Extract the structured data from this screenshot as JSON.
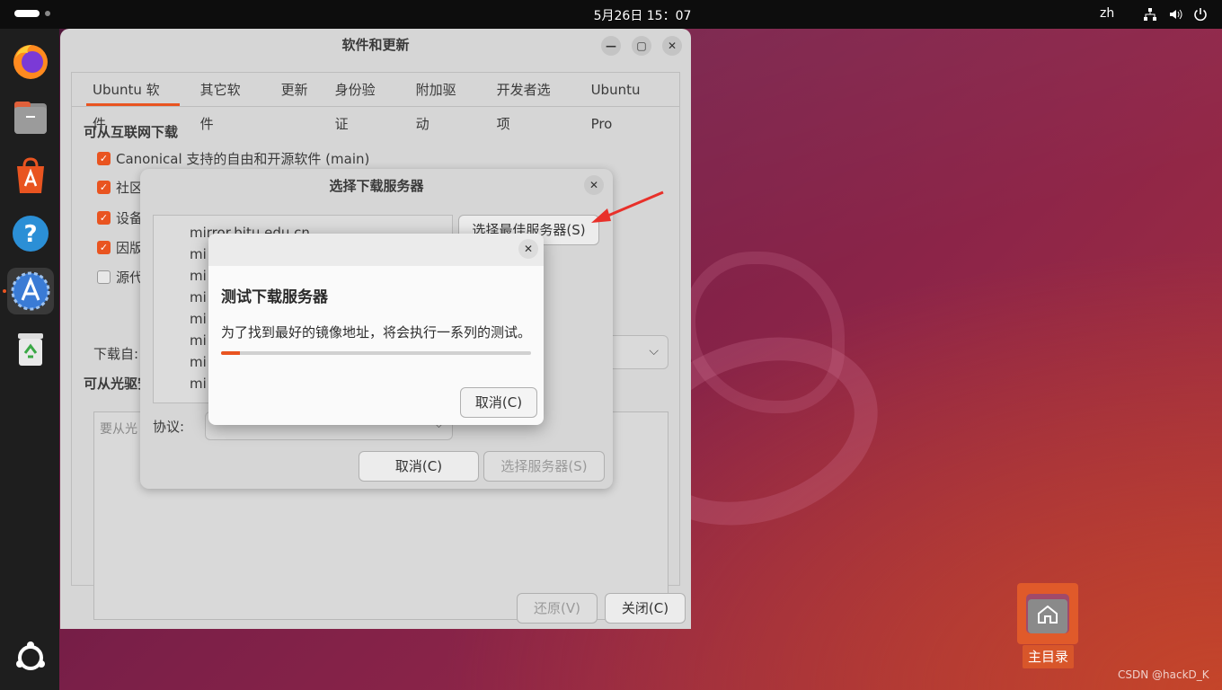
{
  "topbar": {
    "clock": "5月26日  15：07",
    "language": "zh",
    "icons": [
      "network-icon",
      "volume-icon",
      "power-icon"
    ]
  },
  "dock": {
    "apps": [
      "firefox",
      "files",
      "app-center",
      "help",
      "software-updater",
      "trash"
    ],
    "show_apps": "ubuntu-logo"
  },
  "main_window": {
    "title": "软件和更新",
    "tabs": [
      "Ubuntu 软件",
      "其它软件",
      "更新",
      "身份验证",
      "附加驱动",
      "开发者选项",
      "Ubuntu Pro"
    ],
    "active_tab": 0,
    "internet_section": "可从互联网下载",
    "sources": [
      {
        "label": "Canonical 支持的自由和开源软件 (main)",
        "checked": true
      },
      {
        "label": "社区",
        "checked": true
      },
      {
        "label": "设备",
        "checked": true
      },
      {
        "label": "因版",
        "checked": true
      },
      {
        "label": "源代",
        "checked": false
      }
    ],
    "download_from_label": "下载自:",
    "cdrom_section": "可从光驱安",
    "cdrom_placeholder": "要从光",
    "revert_label": "还原(V)",
    "close_label": "关闭(C)"
  },
  "server_dialog": {
    "title": "选择下载服务器",
    "select_best_label": "选择最佳服务器(S)",
    "servers": [
      "mirror.bjtu.edu.cn",
      "mi",
      "mi",
      "mi",
      "mi",
      "mi",
      "mi",
      "mi"
    ],
    "protocol_label": "协议:",
    "cancel_label": "取消(C)",
    "select_label": "选择服务器(S)"
  },
  "progress_dialog": {
    "title": "测试下载服务器",
    "description": "为了找到最好的镜像地址，将会执行一系列的测试。",
    "progress": 0.06,
    "cancel_label": "取消(C)"
  },
  "desktop": {
    "home_label": "主目录",
    "watermark": "CSDN @hackD_K"
  },
  "colors": {
    "accent": "#e95420",
    "annotation": "#e8302a"
  }
}
